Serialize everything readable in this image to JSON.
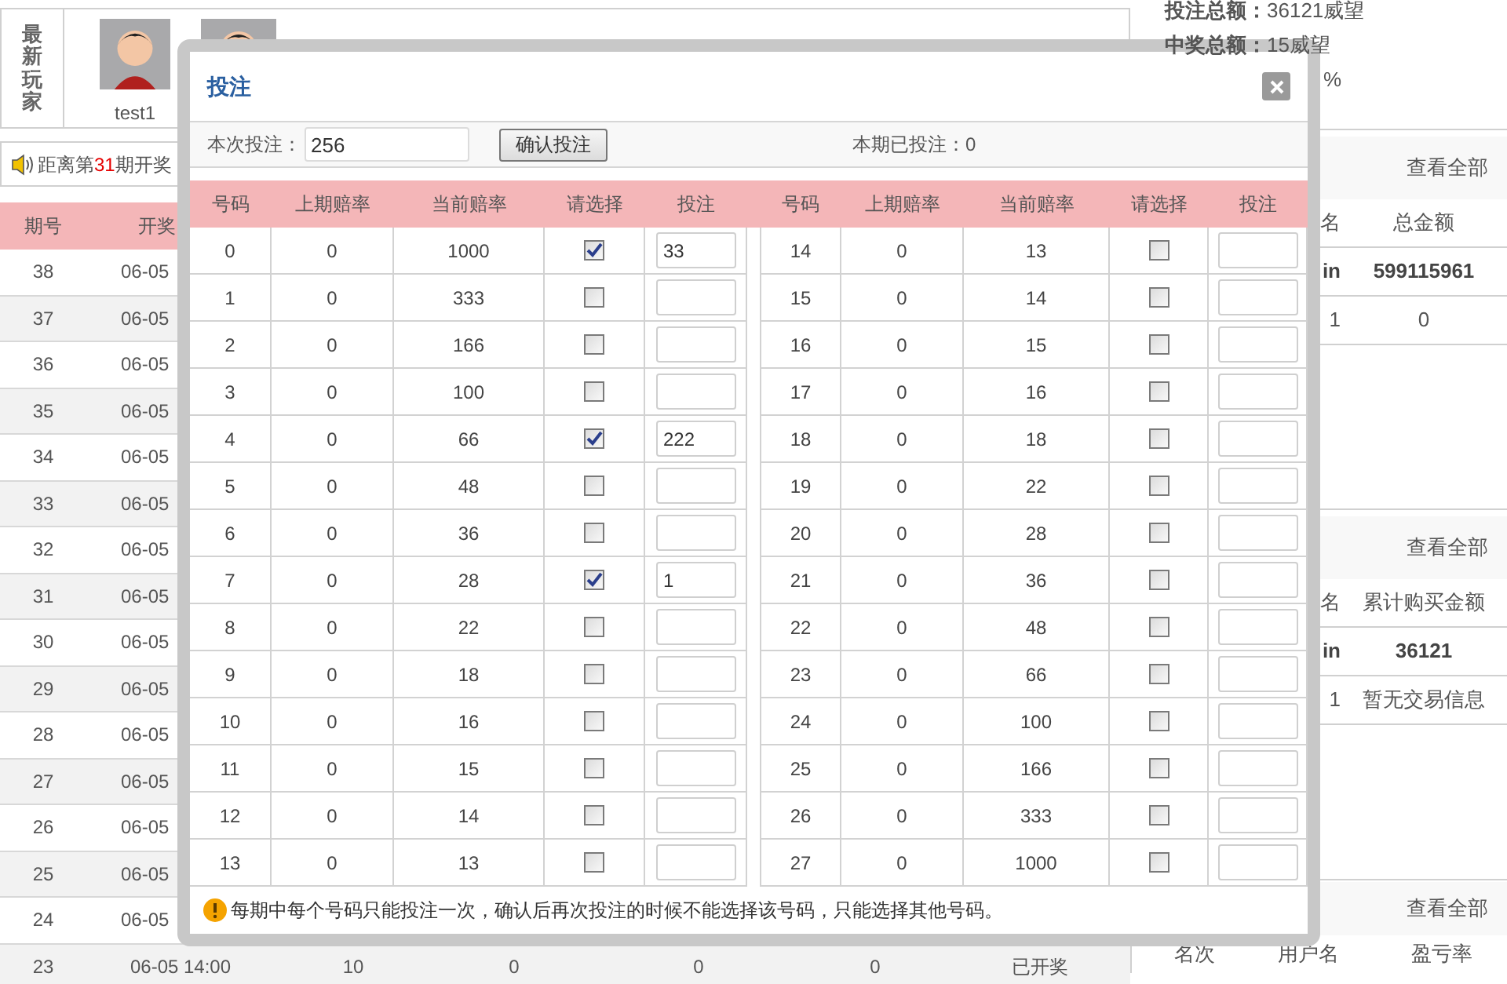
{
  "players_panel": {
    "label": "最新玩家",
    "players": [
      {
        "kind": "named",
        "name": "test1"
      },
      {
        "kind": "avatar_only"
      }
    ]
  },
  "notice": {
    "prefix": "距离第",
    "period": "31",
    "suffix": "期开奖"
  },
  "draw_table": {
    "columns": [
      "期号",
      "开奖"
    ],
    "rows": [
      {
        "period": "38",
        "time": "06-05"
      },
      {
        "period": "37",
        "time": "06-05"
      },
      {
        "period": "36",
        "time": "06-05"
      },
      {
        "period": "35",
        "time": "06-05"
      },
      {
        "period": "34",
        "time": "06-05"
      },
      {
        "period": "33",
        "time": "06-05"
      },
      {
        "period": "32",
        "time": "06-05"
      },
      {
        "period": "31",
        "time": "06-05"
      },
      {
        "period": "30",
        "time": "06-05"
      },
      {
        "period": "29",
        "time": "06-05"
      },
      {
        "period": "28",
        "time": "06-05"
      },
      {
        "period": "27",
        "time": "06-05"
      },
      {
        "period": "26",
        "time": "06-05"
      },
      {
        "period": "25",
        "time": "06-05"
      },
      {
        "period": "24",
        "time": "06-05"
      },
      {
        "period": "23",
        "time": "06-05 14:00",
        "cells": [
          "10",
          "0",
          "0",
          "0",
          "已开奖"
        ]
      }
    ]
  },
  "stats": [
    "**投注总额：**36121威望",
    "**中奖总额：**15威望",
    "%"
  ],
  "rank_panels": [
    {
      "kind": "partly_covered",
      "link": "查看全部",
      "columns": [
        "名",
        "总金额"
      ],
      "rows": [
        {
          "cells": [
            "in",
            "599115961"
          ],
          "highlight": true
        },
        {
          "cells": [
            "1",
            "0"
          ],
          "highlight": false
        }
      ]
    },
    {
      "kind": "partly_covered",
      "link": "查看全部",
      "columns": [
        "名",
        "累计购买金额"
      ],
      "rows": [
        {
          "cells": [
            "in",
            "36121"
          ],
          "highlight": true
        },
        {
          "cells": [
            "1",
            "暂无交易信息"
          ],
          "highlight": false
        }
      ]
    },
    {
      "kind": "full",
      "link": "查看全部",
      "columns": [
        "名次",
        "用户名",
        "盈亏率"
      ]
    }
  ],
  "dialog": {
    "title": "投注",
    "bet_label": "本次投注：",
    "bet_amount": "256",
    "confirm_button": "确认投注",
    "placed_label": "本期已投注：0",
    "columns": [
      "号码",
      "上期赔率",
      "当前赔率",
      "请选择",
      "投注",
      "号码",
      "上期赔率",
      "当前赔率",
      "请选择",
      "投注"
    ],
    "bets": [
      {
        "number": "0",
        "previous_odds": "0",
        "current_odds": "1000",
        "checked": true,
        "amount": "33"
      },
      {
        "number": "1",
        "previous_odds": "0",
        "current_odds": "333",
        "checked": false
      },
      {
        "number": "2",
        "previous_odds": "0",
        "current_odds": "166",
        "checked": false
      },
      {
        "number": "3",
        "previous_odds": "0",
        "current_odds": "100",
        "checked": false
      },
      {
        "number": "4",
        "previous_odds": "0",
        "current_odds": "66",
        "checked": true,
        "amount": "222"
      },
      {
        "number": "5",
        "previous_odds": "0",
        "current_odds": "48",
        "checked": false
      },
      {
        "number": "6",
        "previous_odds": "0",
        "current_odds": "36",
        "checked": false
      },
      {
        "number": "7",
        "previous_odds": "0",
        "current_odds": "28",
        "checked": true,
        "amount": "1"
      },
      {
        "number": "8",
        "previous_odds": "0",
        "current_odds": "22",
        "checked": false
      },
      {
        "number": "9",
        "previous_odds": "0",
        "current_odds": "18",
        "checked": false
      },
      {
        "number": "10",
        "previous_odds": "0",
        "current_odds": "16",
        "checked": false
      },
      {
        "number": "11",
        "previous_odds": "0",
        "current_odds": "15",
        "checked": false
      },
      {
        "number": "12",
        "previous_odds": "0",
        "current_odds": "14",
        "checked": false
      },
      {
        "number": "13",
        "previous_odds": "0",
        "current_odds": "13",
        "checked": false
      },
      {
        "number": "14",
        "previous_odds": "0",
        "current_odds": "13",
        "checked": false
      },
      {
        "number": "15",
        "previous_odds": "0",
        "current_odds": "14",
        "checked": false
      },
      {
        "number": "16",
        "previous_odds": "0",
        "current_odds": "15",
        "checked": false
      },
      {
        "number": "17",
        "previous_odds": "0",
        "current_odds": "16",
        "checked": false
      },
      {
        "number": "18",
        "previous_odds": "0",
        "current_odds": "18",
        "checked": false
      },
      {
        "number": "19",
        "previous_odds": "0",
        "current_odds": "22",
        "checked": false
      },
      {
        "number": "20",
        "previous_odds": "0",
        "current_odds": "28",
        "checked": false
      },
      {
        "number": "21",
        "previous_odds": "0",
        "current_odds": "36",
        "checked": false
      },
      {
        "number": "22",
        "previous_odds": "0",
        "current_odds": "48",
        "checked": false
      },
      {
        "number": "23",
        "previous_odds": "0",
        "current_odds": "66",
        "checked": false
      },
      {
        "number": "24",
        "previous_odds": "0",
        "current_odds": "100",
        "checked": false
      },
      {
        "number": "25",
        "previous_odds": "0",
        "current_odds": "166",
        "checked": false
      },
      {
        "number": "26",
        "previous_odds": "0",
        "current_odds": "333",
        "checked": false
      },
      {
        "number": "27",
        "previous_odds": "0",
        "current_odds": "1000",
        "checked": false
      }
    ],
    "notice": "每期中每个号码只能投注一次，确认后再次投注的时候不能选择该号码，只能选择其他号码。"
  }
}
